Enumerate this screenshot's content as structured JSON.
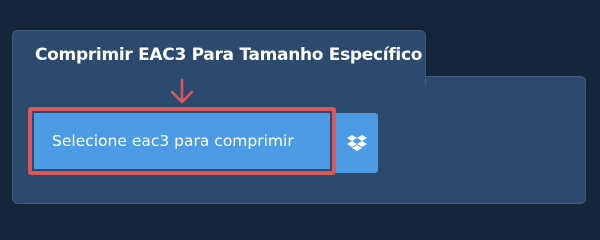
{
  "tool": {
    "title": "Comprimir EAC3 Para Tamanho Específico",
    "select_button_label": "Selecione eac3 para comprimir"
  },
  "icons": {
    "arrow": "arrow-down-icon",
    "dropbox": "dropbox-icon"
  },
  "colors": {
    "background": "#14253a",
    "panel": "#2b4a6d",
    "button": "#4e9be5",
    "highlight": "#d9595d",
    "text": "#ffffff"
  }
}
